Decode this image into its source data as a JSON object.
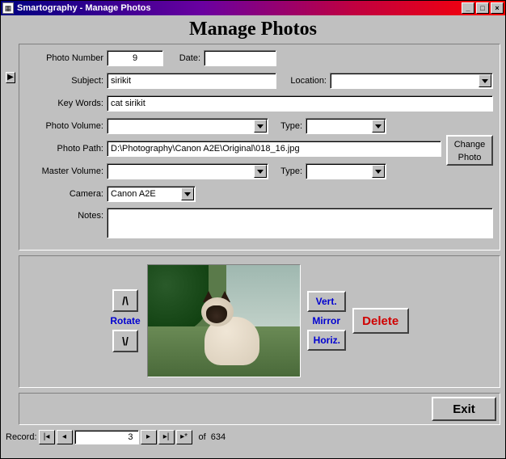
{
  "window": {
    "title": "Smartography - Manage Photos"
  },
  "header": {
    "page_title": "Manage Photos"
  },
  "labels": {
    "photo_number": "Photo Number",
    "date": "Date:",
    "subject": "Subject:",
    "location": "Location:",
    "keywords": "Key Words:",
    "photo_volume": "Photo Volume:",
    "type1": "Type:",
    "photo_path": "Photo Path:",
    "master_volume": "Master Volume:",
    "type2": "Type:",
    "camera": "Camera:",
    "notes": "Notes:",
    "rotate": "Rotate",
    "mirror": "Mirror"
  },
  "fields": {
    "photo_number": "9",
    "date": "",
    "subject": "sirikit",
    "location": "",
    "keywords": "cat sirikit",
    "photo_volume": "",
    "type1": "",
    "photo_path": "D:\\Photography\\Canon A2E\\Original\\018_16.jpg",
    "master_volume": "",
    "type2": "",
    "camera": "Canon A2E",
    "notes": ""
  },
  "buttons": {
    "change_photo": "Change Photo",
    "rotate_up": "/\\",
    "rotate_down": "\\/",
    "mirror_vert": "Vert.",
    "mirror_horiz": "Horiz.",
    "delete": "Delete",
    "exit": "Exit"
  },
  "record_nav": {
    "label": "Record:",
    "current": "3",
    "of_label": "of",
    "total": "634"
  }
}
